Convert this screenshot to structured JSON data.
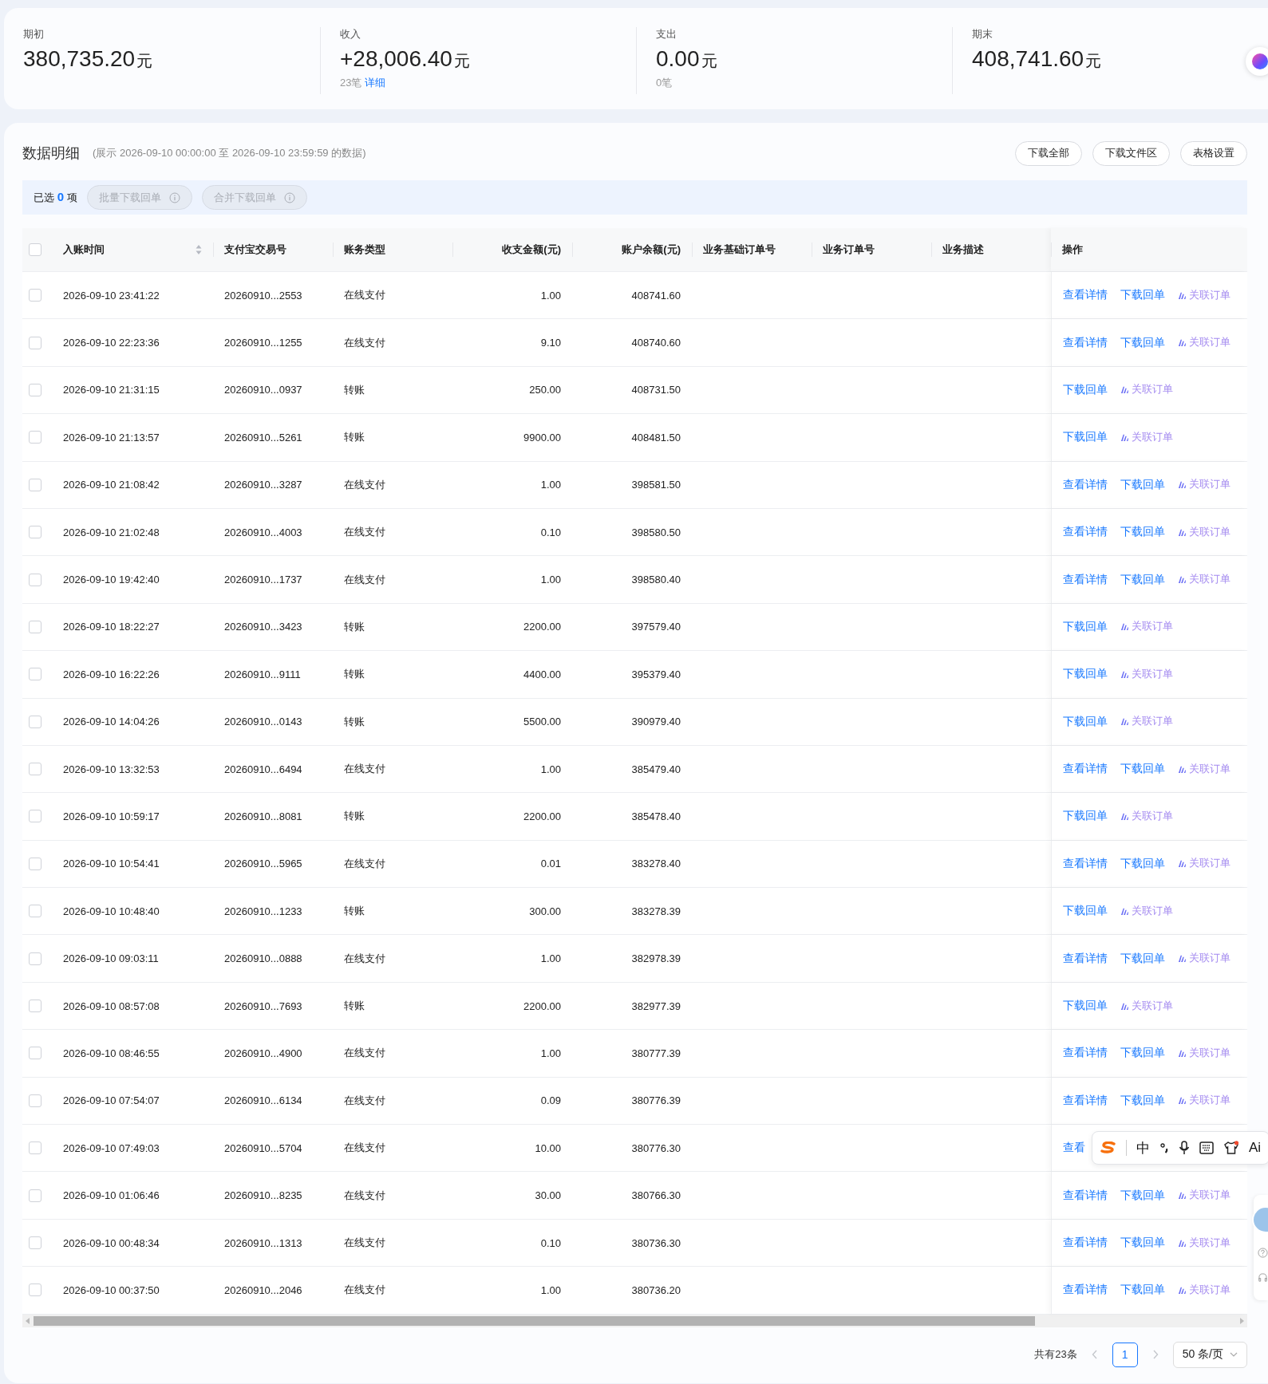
{
  "summary": [
    {
      "label": "期初",
      "value": "380,735.20",
      "unit": "元"
    },
    {
      "label": "收入",
      "value": "+28,006.40",
      "unit": "元",
      "count": "23笔",
      "link": "详细"
    },
    {
      "label": "支出",
      "value": "0.00",
      "unit": "元",
      "count": "0笔"
    },
    {
      "label": "期末",
      "value": "408,741.60",
      "unit": "元"
    }
  ],
  "detail": {
    "title": "数据明细",
    "range": "(展示 2026-09-10 00:00:00 至 2026-09-10 23:59:59 的数据)",
    "buttons": [
      "下载全部",
      "下载文件区",
      "表格设置"
    ],
    "selection": {
      "prefix": "已选",
      "count": "0",
      "suffix": "项",
      "buttons": [
        {
          "label": "批量下载回单",
          "disabled": true
        },
        {
          "label": "合并下载回单",
          "disabled": true
        }
      ]
    }
  },
  "table": {
    "select_all": {
      "checked": false
    },
    "columns": [
      {
        "label": "入账时间",
        "sortable": true
      },
      {
        "label": "支付宝交易号",
        "sortable": false
      },
      {
        "label": "账务类型",
        "sortable": false
      },
      {
        "label": "收支金额(元)",
        "sortable": false
      },
      {
        "label": "账户余额(元)",
        "sortable": false
      },
      {
        "label": "业务基础订单号",
        "sortable": false
      },
      {
        "label": "业务订单号",
        "sortable": false
      },
      {
        "label": "业务描述",
        "sortable": false
      },
      {
        "label": "操作",
        "sortable": false
      }
    ],
    "rows": [
      {
        "checked": false,
        "time": "2026-09-10 23:41:22",
        "trade_no": "20260910...2553",
        "type": "在线支付",
        "amount": "1.00",
        "balance": "408741.60",
        "actions": [
          {
            "text": "查看详情",
            "kind": "link"
          },
          {
            "text": "下载回单",
            "kind": "link"
          },
          {
            "text": "关联订单",
            "kind": "ai"
          }
        ]
      },
      {
        "checked": false,
        "time": "2026-09-10 22:23:36",
        "trade_no": "20260910...1255",
        "type": "在线支付",
        "amount": "9.10",
        "balance": "408740.60",
        "actions": [
          {
            "text": "查看详情",
            "kind": "link"
          },
          {
            "text": "下载回单",
            "kind": "link"
          },
          {
            "text": "关联订单",
            "kind": "ai"
          }
        ]
      },
      {
        "checked": false,
        "time": "2026-09-10 21:31:15",
        "trade_no": "20260910...0937",
        "type": "转账",
        "amount": "250.00",
        "balance": "408731.50",
        "actions": [
          {
            "text": "下载回单",
            "kind": "link"
          },
          {
            "text": "关联订单",
            "kind": "ai"
          }
        ]
      },
      {
        "checked": false,
        "time": "2026-09-10 21:13:57",
        "trade_no": "20260910...5261",
        "type": "转账",
        "amount": "9900.00",
        "balance": "408481.50",
        "actions": [
          {
            "text": "下载回单",
            "kind": "link"
          },
          {
            "text": "关联订单",
            "kind": "ai"
          }
        ]
      },
      {
        "checked": false,
        "time": "2026-09-10 21:08:42",
        "trade_no": "20260910...3287",
        "type": "在线支付",
        "amount": "1.00",
        "balance": "398581.50",
        "actions": [
          {
            "text": "查看详情",
            "kind": "link"
          },
          {
            "text": "下载回单",
            "kind": "link"
          },
          {
            "text": "关联订单",
            "kind": "ai"
          }
        ]
      },
      {
        "checked": false,
        "time": "2026-09-10 21:02:48",
        "trade_no": "20260910...4003",
        "type": "在线支付",
        "amount": "0.10",
        "balance": "398580.50",
        "actions": [
          {
            "text": "查看详情",
            "kind": "link"
          },
          {
            "text": "下载回单",
            "kind": "link"
          },
          {
            "text": "关联订单",
            "kind": "ai"
          }
        ]
      },
      {
        "checked": false,
        "time": "2026-09-10 19:42:40",
        "trade_no": "20260910...1737",
        "type": "在线支付",
        "amount": "1.00",
        "balance": "398580.40",
        "actions": [
          {
            "text": "查看详情",
            "kind": "link"
          },
          {
            "text": "下载回单",
            "kind": "link"
          },
          {
            "text": "关联订单",
            "kind": "ai"
          }
        ]
      },
      {
        "checked": false,
        "time": "2026-09-10 18:22:27",
        "trade_no": "20260910...3423",
        "type": "转账",
        "amount": "2200.00",
        "balance": "397579.40",
        "actions": [
          {
            "text": "下载回单",
            "kind": "link"
          },
          {
            "text": "关联订单",
            "kind": "ai"
          }
        ]
      },
      {
        "checked": false,
        "time": "2026-09-10 16:22:26",
        "trade_no": "20260910...9111",
        "type": "转账",
        "amount": "4400.00",
        "balance": "395379.40",
        "actions": [
          {
            "text": "下载回单",
            "kind": "link"
          },
          {
            "text": "关联订单",
            "kind": "ai"
          }
        ]
      },
      {
        "checked": false,
        "time": "2026-09-10 14:04:26",
        "trade_no": "20260910...0143",
        "type": "转账",
        "amount": "5500.00",
        "balance": "390979.40",
        "actions": [
          {
            "text": "下载回单",
            "kind": "link"
          },
          {
            "text": "关联订单",
            "kind": "ai"
          }
        ]
      },
      {
        "checked": false,
        "time": "2026-09-10 13:32:53",
        "trade_no": "20260910...6494",
        "type": "在线支付",
        "amount": "1.00",
        "balance": "385479.40",
        "actions": [
          {
            "text": "查看详情",
            "kind": "link"
          },
          {
            "text": "下载回单",
            "kind": "link"
          },
          {
            "text": "关联订单",
            "kind": "ai"
          }
        ]
      },
      {
        "checked": false,
        "time": "2026-09-10 10:59:17",
        "trade_no": "20260910...8081",
        "type": "转账",
        "amount": "2200.00",
        "balance": "385478.40",
        "actions": [
          {
            "text": "下载回单",
            "kind": "link"
          },
          {
            "text": "关联订单",
            "kind": "ai"
          }
        ]
      },
      {
        "checked": false,
        "time": "2026-09-10 10:54:41",
        "trade_no": "20260910...5965",
        "type": "在线支付",
        "amount": "0.01",
        "balance": "383278.40",
        "actions": [
          {
            "text": "查看详情",
            "kind": "link"
          },
          {
            "text": "下载回单",
            "kind": "link"
          },
          {
            "text": "关联订单",
            "kind": "ai"
          }
        ]
      },
      {
        "checked": false,
        "time": "2026-09-10 10:48:40",
        "trade_no": "20260910...1233",
        "type": "转账",
        "amount": "300.00",
        "balance": "383278.39",
        "actions": [
          {
            "text": "下载回单",
            "kind": "link"
          },
          {
            "text": "关联订单",
            "kind": "ai"
          }
        ]
      },
      {
        "checked": false,
        "time": "2026-09-10 09:03:11",
        "trade_no": "20260910...0888",
        "type": "在线支付",
        "amount": "1.00",
        "balance": "382978.39",
        "actions": [
          {
            "text": "查看详情",
            "kind": "link"
          },
          {
            "text": "下载回单",
            "kind": "link"
          },
          {
            "text": "关联订单",
            "kind": "ai"
          }
        ]
      },
      {
        "checked": false,
        "time": "2026-09-10 08:57:08",
        "trade_no": "20260910...7693",
        "type": "转账",
        "amount": "2200.00",
        "balance": "382977.39",
        "actions": [
          {
            "text": "下载回单",
            "kind": "link"
          },
          {
            "text": "关联订单",
            "kind": "ai"
          }
        ]
      },
      {
        "checked": false,
        "time": "2026-09-10 08:46:55",
        "trade_no": "20260910...4900",
        "type": "在线支付",
        "amount": "1.00",
        "balance": "380777.39",
        "actions": [
          {
            "text": "查看详情",
            "kind": "link"
          },
          {
            "text": "下载回单",
            "kind": "link"
          },
          {
            "text": "关联订单",
            "kind": "ai"
          }
        ]
      },
      {
        "checked": false,
        "time": "2026-09-10 07:54:07",
        "trade_no": "20260910...6134",
        "type": "在线支付",
        "amount": "0.09",
        "balance": "380776.39",
        "actions": [
          {
            "text": "查看详情",
            "kind": "link"
          },
          {
            "text": "下载回单",
            "kind": "link"
          },
          {
            "text": "关联订单",
            "kind": "ai"
          }
        ]
      },
      {
        "checked": false,
        "time": "2026-09-10 07:49:03",
        "trade_no": "20260910...5704",
        "type": "在线支付",
        "amount": "10.00",
        "balance": "380776.30",
        "actions": [
          {
            "text": "查看",
            "kind": "link"
          }
        ],
        "ime_overlay": true
      },
      {
        "checked": false,
        "time": "2026-09-10 01:06:46",
        "trade_no": "20260910...8235",
        "type": "在线支付",
        "amount": "30.00",
        "balance": "380766.30",
        "actions": [
          {
            "text": "查看详情",
            "kind": "link"
          },
          {
            "text": "下载回单",
            "kind": "link"
          },
          {
            "text": "关联订单",
            "kind": "ai"
          }
        ]
      },
      {
        "checked": false,
        "time": "2026-09-10 00:48:34",
        "trade_no": "20260910...1313",
        "type": "在线支付",
        "amount": "0.10",
        "balance": "380736.30",
        "actions": [
          {
            "text": "查看详情",
            "kind": "link"
          },
          {
            "text": "下载回单",
            "kind": "link"
          },
          {
            "text": "关联订单",
            "kind": "ai"
          }
        ]
      },
      {
        "checked": false,
        "time": "2026-09-10 00:37:50",
        "trade_no": "20260910...2046",
        "type": "在线支付",
        "amount": "1.00",
        "balance": "380736.20",
        "actions": [
          {
            "text": "查看详情",
            "kind": "link"
          },
          {
            "text": "下载回单",
            "kind": "link"
          },
          {
            "text": "关联订单",
            "kind": "ai"
          }
        ]
      }
    ]
  },
  "ime_toolbar": {
    "mode": "中",
    "ai": "Ai"
  },
  "pagination": {
    "total": "共有23条",
    "pages": [
      {
        "label": "1",
        "selected": true
      }
    ],
    "page_size": "50 条/页"
  }
}
